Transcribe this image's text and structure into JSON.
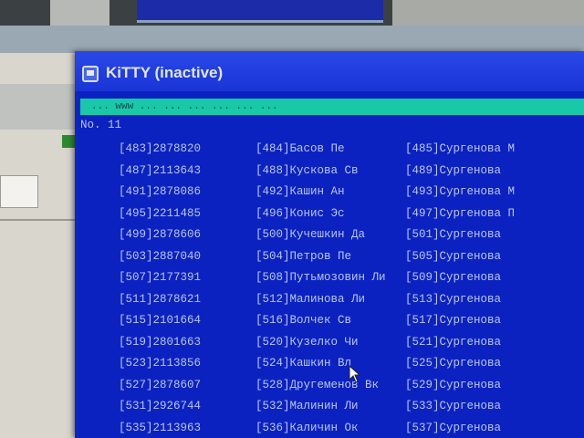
{
  "window": {
    "title": "KiTTY (inactive)",
    "status_line": "...  www  ...  ...  ...  ...  ...  ...",
    "prompt": "No. 11"
  },
  "icons": {
    "app": "kitty-app-icon",
    "pointer": "mouse-pointer-icon"
  },
  "colors": {
    "terminal_bg": "#0c22c0",
    "status_bar": "#18c8a6",
    "text": "#b8c4f0"
  },
  "rows": [
    {
      "c1": "[483]2878820",
      "c2": "[484]Басов Пе",
      "c3": "[485]Сургенова М"
    },
    {
      "c1": "[487]2113643",
      "c2": "[488]Кускова Св",
      "c3": "[489]Сургенова"
    },
    {
      "c1": "[491]2878086",
      "c2": "[492]Кашин Ан",
      "c3": "[493]Сургенова М"
    },
    {
      "c1": "[495]2211485",
      "c2": "[496]Конис Эс",
      "c3": "[497]Сургенова П"
    },
    {
      "c1": "[499]2878606",
      "c2": "[500]Кучешкин Да",
      "c3": "[501]Сургенова"
    },
    {
      "c1": "[503]2887040",
      "c2": "[504]Петров Пе",
      "c3": "[505]Сургенова"
    },
    {
      "c1": "[507]2177391",
      "c2": "[508]Путьмозовин Ли",
      "c3": "[509]Сургенова"
    },
    {
      "c1": "[511]2878621",
      "c2": "[512]Малинова Ли",
      "c3": "[513]Сургенова"
    },
    {
      "c1": "[515]2101664",
      "c2": "[516]Волчек Св",
      "c3": "[517]Сургенова"
    },
    {
      "c1": "[519]2801663",
      "c2": "[520]Кузелко Чи",
      "c3": "[521]Сургенова"
    },
    {
      "c1": "[523]2113856",
      "c2": "[524]Кашкин Вл",
      "c3": "[525]Сургенова"
    },
    {
      "c1": "[527]2878607",
      "c2": "[528]Другеменов Вк",
      "c3": "[529]Сургенова"
    },
    {
      "c1": "[531]2926744",
      "c2": "[532]Малинин Ли",
      "c3": "[533]Сургенова"
    },
    {
      "c1": "[535]2113963",
      "c2": "[536]Каличин Ок",
      "c3": "[537]Сургенова"
    }
  ]
}
